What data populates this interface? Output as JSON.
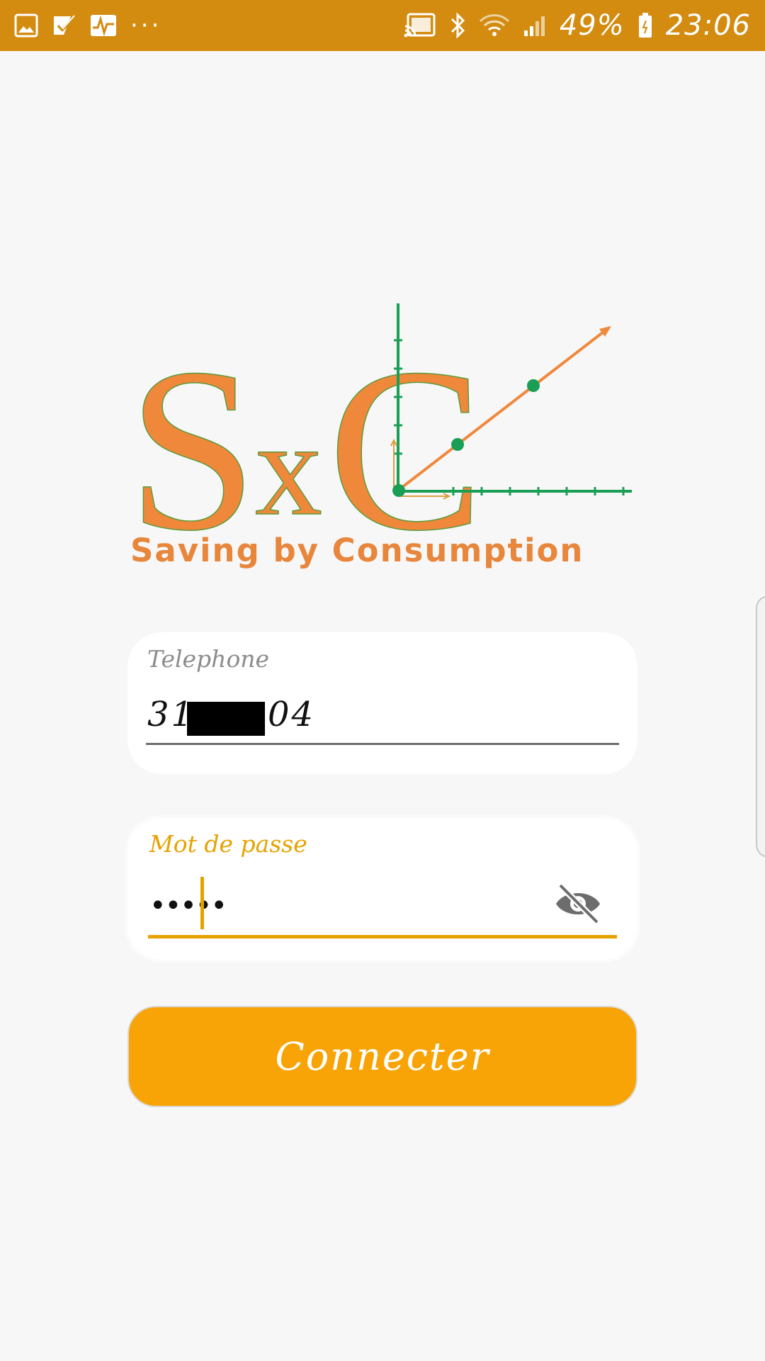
{
  "status_bar": {
    "left_icons": [
      "gallery-icon",
      "task-check-icon",
      "activity-icon"
    ],
    "overflow": "···",
    "right_icons": [
      "cast-icon",
      "bluetooth-icon",
      "wifi-icon",
      "signal-icon"
    ],
    "battery_percent": "49%",
    "time": "23:06"
  },
  "logo": {
    "mark_letters": [
      "S",
      "x",
      "C"
    ],
    "tagline": "Saving by Consumption",
    "colors": {
      "orange": "#f0883c",
      "green": "#1a9e55"
    }
  },
  "form": {
    "phone": {
      "label": "Telephone",
      "value_prefix": "31",
      "value_suffix": "04"
    },
    "password": {
      "label": "Mot de passe",
      "masked_value": "•••••",
      "visibility_icon": "eye-off-icon"
    },
    "submit_label": "Connecter"
  },
  "theme": {
    "status_bar": "#d38b10",
    "accent": "#f8a406",
    "background": "#f7f7f7"
  }
}
